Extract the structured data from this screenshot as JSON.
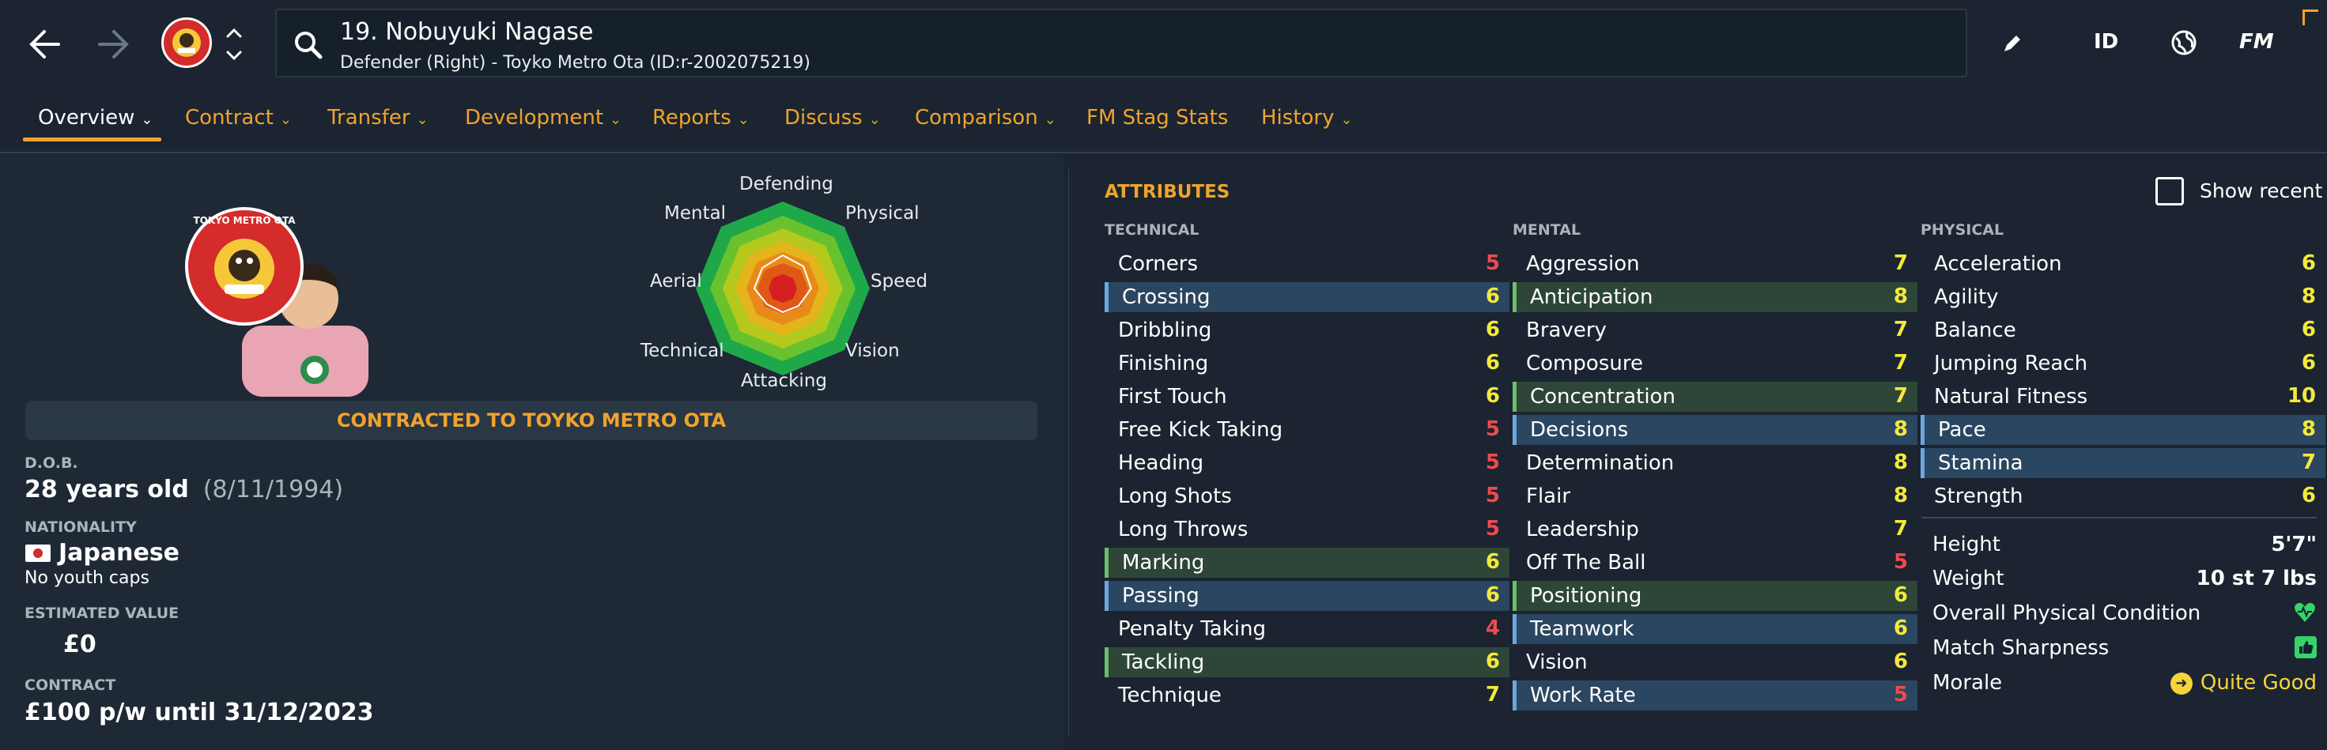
{
  "header": {
    "player_name": "19. Nobuyuki Nagase",
    "player_sub": "Defender (Right) - Toyko Metro Ota (ID:r-2002075219)",
    "right_icons": {
      "edit": "pencil-icon",
      "id": "ID",
      "globe": "globe-icon",
      "fm": "FM"
    }
  },
  "tabs": [
    {
      "label": "Overview"
    },
    {
      "label": "Contract"
    },
    {
      "label": "Transfer"
    },
    {
      "label": "Development"
    },
    {
      "label": "Reports"
    },
    {
      "label": "Discuss"
    },
    {
      "label": "Comparison"
    },
    {
      "label": "FM Stag Stats"
    },
    {
      "label": "History"
    }
  ],
  "radar": {
    "labels": {
      "defending": "Defending",
      "physical": "Physical",
      "speed": "Speed",
      "vision": "Vision",
      "attacking": "Attacking",
      "technical": "Technical",
      "aerial": "Aerial",
      "mental": "Mental"
    }
  },
  "club_logo_text": "TOKYO METRO OTA",
  "contracted_banner": "CONTRACTED TO TOYKO METRO OTA",
  "profile": {
    "dob_label": "D.O.B.",
    "age": "28 years old",
    "dob": "(8/11/1994)",
    "nationality_label": "NATIONALITY",
    "nationality": "Japanese",
    "caps": "No youth caps",
    "value_label": "ESTIMATED VALUE",
    "value": "£0",
    "contract_label": "CONTRACT",
    "contract": "£100 p/w until 31/12/2023"
  },
  "attributes": {
    "title": "ATTRIBUTES",
    "show_recent": "Show recent",
    "technical_label": "TECHNICAL",
    "mental_label": "MENTAL",
    "physical_label": "PHYSICAL",
    "technical": [
      {
        "name": "Corners",
        "value": "5"
      },
      {
        "name": "Crossing",
        "value": "6"
      },
      {
        "name": "Dribbling",
        "value": "6"
      },
      {
        "name": "Finishing",
        "value": "6"
      },
      {
        "name": "First Touch",
        "value": "6"
      },
      {
        "name": "Free Kick Taking",
        "value": "5"
      },
      {
        "name": "Heading",
        "value": "5"
      },
      {
        "name": "Long Shots",
        "value": "5"
      },
      {
        "name": "Long Throws",
        "value": "5"
      },
      {
        "name": "Marking",
        "value": "6"
      },
      {
        "name": "Passing",
        "value": "6"
      },
      {
        "name": "Penalty Taking",
        "value": "4"
      },
      {
        "name": "Tackling",
        "value": "6"
      },
      {
        "name": "Technique",
        "value": "7"
      }
    ],
    "mental": [
      {
        "name": "Aggression",
        "value": "7"
      },
      {
        "name": "Anticipation",
        "value": "8"
      },
      {
        "name": "Bravery",
        "value": "7"
      },
      {
        "name": "Composure",
        "value": "7"
      },
      {
        "name": "Concentration",
        "value": "7"
      },
      {
        "name": "Decisions",
        "value": "8"
      },
      {
        "name": "Determination",
        "value": "8"
      },
      {
        "name": "Flair",
        "value": "8"
      },
      {
        "name": "Leadership",
        "value": "7"
      },
      {
        "name": "Off The Ball",
        "value": "5"
      },
      {
        "name": "Positioning",
        "value": "6"
      },
      {
        "name": "Teamwork",
        "value": "6"
      },
      {
        "name": "Vision",
        "value": "6"
      },
      {
        "name": "Work Rate",
        "value": "5"
      }
    ],
    "physical": [
      {
        "name": "Acceleration",
        "value": "6"
      },
      {
        "name": "Agility",
        "value": "8"
      },
      {
        "name": "Balance",
        "value": "6"
      },
      {
        "name": "Jumping Reach",
        "value": "6"
      },
      {
        "name": "Natural Fitness",
        "value": "10"
      },
      {
        "name": "Pace",
        "value": "8"
      },
      {
        "name": "Stamina",
        "value": "7"
      },
      {
        "name": "Strength",
        "value": "6"
      }
    ]
  },
  "physical_info": {
    "height_label": "Height",
    "height": "5'7\"",
    "weight_label": "Weight",
    "weight": "10 st 7 lbs",
    "condition_label": "Overall Physical Condition",
    "sharpness_label": "Match Sharpness",
    "morale_label": "Morale",
    "morale": "Quite Good"
  }
}
